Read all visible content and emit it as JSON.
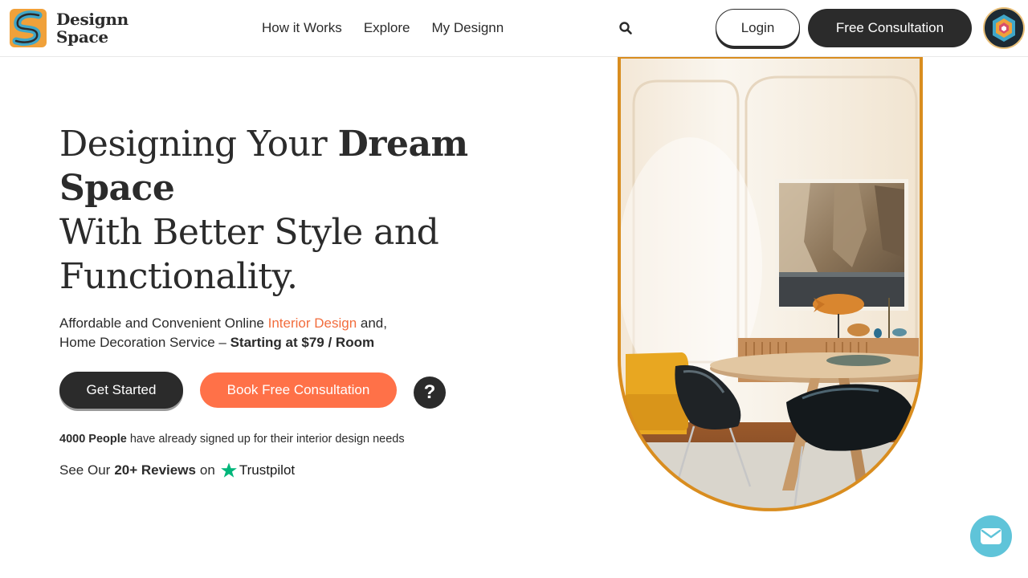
{
  "header": {
    "logo": {
      "line1": "Designn",
      "line2": "Space"
    },
    "nav": [
      {
        "label": "How it Works"
      },
      {
        "label": "Explore"
      },
      {
        "label": "My Designn"
      }
    ],
    "login_label": "Login",
    "consult_label": "Free Consultation"
  },
  "hero": {
    "title_part1": "Designing Your ",
    "title_bold": "Dream Space",
    "title_part2": "With Better Style and Functionality.",
    "sub_part1": "Affordable and Convenient Online ",
    "sub_accent": "Interior Design",
    "sub_part2": " and,",
    "sub_part3": "Home Decoration Service – ",
    "sub_bold": "Starting at $79 / Room",
    "get_started_label": "Get Started",
    "book_label": "Book Free Consultation",
    "help_label": "?",
    "signup_count": "4000 People",
    "signup_text": " have already signed up for their interior design needs",
    "reviews_prefix": "See Our",
    "reviews_count": "20+ Reviews",
    "reviews_on": "on",
    "trustpilot_label": "Trustpilot"
  },
  "icons": {
    "logo": "logo-icon",
    "search": "search-icon",
    "avatar": "avatar-icon",
    "help": "question-icon",
    "trustpilot": "star-icon",
    "chat": "envelope-icon"
  },
  "colors": {
    "dark": "#2b2b2b",
    "accent": "#ff7148",
    "accent_text": "#f26d3d",
    "frame": "#d98d1f",
    "trustpilot": "#00b67a",
    "chat": "#5fc4d9"
  }
}
